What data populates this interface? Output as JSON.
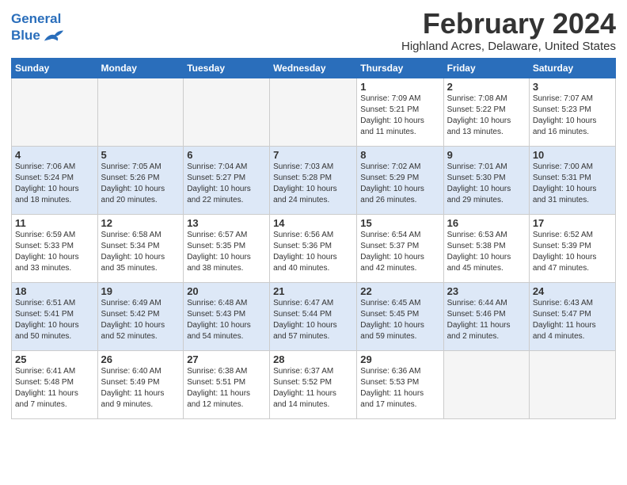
{
  "header": {
    "logo_line1": "General",
    "logo_line2": "Blue",
    "month": "February 2024",
    "location": "Highland Acres, Delaware, United States"
  },
  "days_of_week": [
    "Sunday",
    "Monday",
    "Tuesday",
    "Wednesday",
    "Thursday",
    "Friday",
    "Saturday"
  ],
  "weeks": [
    [
      {
        "day": "",
        "info": ""
      },
      {
        "day": "",
        "info": ""
      },
      {
        "day": "",
        "info": ""
      },
      {
        "day": "",
        "info": ""
      },
      {
        "day": "1",
        "info": "Sunrise: 7:09 AM\nSunset: 5:21 PM\nDaylight: 10 hours\nand 11 minutes."
      },
      {
        "day": "2",
        "info": "Sunrise: 7:08 AM\nSunset: 5:22 PM\nDaylight: 10 hours\nand 13 minutes."
      },
      {
        "day": "3",
        "info": "Sunrise: 7:07 AM\nSunset: 5:23 PM\nDaylight: 10 hours\nand 16 minutes."
      }
    ],
    [
      {
        "day": "4",
        "info": "Sunrise: 7:06 AM\nSunset: 5:24 PM\nDaylight: 10 hours\nand 18 minutes."
      },
      {
        "day": "5",
        "info": "Sunrise: 7:05 AM\nSunset: 5:26 PM\nDaylight: 10 hours\nand 20 minutes."
      },
      {
        "day": "6",
        "info": "Sunrise: 7:04 AM\nSunset: 5:27 PM\nDaylight: 10 hours\nand 22 minutes."
      },
      {
        "day": "7",
        "info": "Sunrise: 7:03 AM\nSunset: 5:28 PM\nDaylight: 10 hours\nand 24 minutes."
      },
      {
        "day": "8",
        "info": "Sunrise: 7:02 AM\nSunset: 5:29 PM\nDaylight: 10 hours\nand 26 minutes."
      },
      {
        "day": "9",
        "info": "Sunrise: 7:01 AM\nSunset: 5:30 PM\nDaylight: 10 hours\nand 29 minutes."
      },
      {
        "day": "10",
        "info": "Sunrise: 7:00 AM\nSunset: 5:31 PM\nDaylight: 10 hours\nand 31 minutes."
      }
    ],
    [
      {
        "day": "11",
        "info": "Sunrise: 6:59 AM\nSunset: 5:33 PM\nDaylight: 10 hours\nand 33 minutes."
      },
      {
        "day": "12",
        "info": "Sunrise: 6:58 AM\nSunset: 5:34 PM\nDaylight: 10 hours\nand 35 minutes."
      },
      {
        "day": "13",
        "info": "Sunrise: 6:57 AM\nSunset: 5:35 PM\nDaylight: 10 hours\nand 38 minutes."
      },
      {
        "day": "14",
        "info": "Sunrise: 6:56 AM\nSunset: 5:36 PM\nDaylight: 10 hours\nand 40 minutes."
      },
      {
        "day": "15",
        "info": "Sunrise: 6:54 AM\nSunset: 5:37 PM\nDaylight: 10 hours\nand 42 minutes."
      },
      {
        "day": "16",
        "info": "Sunrise: 6:53 AM\nSunset: 5:38 PM\nDaylight: 10 hours\nand 45 minutes."
      },
      {
        "day": "17",
        "info": "Sunrise: 6:52 AM\nSunset: 5:39 PM\nDaylight: 10 hours\nand 47 minutes."
      }
    ],
    [
      {
        "day": "18",
        "info": "Sunrise: 6:51 AM\nSunset: 5:41 PM\nDaylight: 10 hours\nand 50 minutes."
      },
      {
        "day": "19",
        "info": "Sunrise: 6:49 AM\nSunset: 5:42 PM\nDaylight: 10 hours\nand 52 minutes."
      },
      {
        "day": "20",
        "info": "Sunrise: 6:48 AM\nSunset: 5:43 PM\nDaylight: 10 hours\nand 54 minutes."
      },
      {
        "day": "21",
        "info": "Sunrise: 6:47 AM\nSunset: 5:44 PM\nDaylight: 10 hours\nand 57 minutes."
      },
      {
        "day": "22",
        "info": "Sunrise: 6:45 AM\nSunset: 5:45 PM\nDaylight: 10 hours\nand 59 minutes."
      },
      {
        "day": "23",
        "info": "Sunrise: 6:44 AM\nSunset: 5:46 PM\nDaylight: 11 hours\nand 2 minutes."
      },
      {
        "day": "24",
        "info": "Sunrise: 6:43 AM\nSunset: 5:47 PM\nDaylight: 11 hours\nand 4 minutes."
      }
    ],
    [
      {
        "day": "25",
        "info": "Sunrise: 6:41 AM\nSunset: 5:48 PM\nDaylight: 11 hours\nand 7 minutes."
      },
      {
        "day": "26",
        "info": "Sunrise: 6:40 AM\nSunset: 5:49 PM\nDaylight: 11 hours\nand 9 minutes."
      },
      {
        "day": "27",
        "info": "Sunrise: 6:38 AM\nSunset: 5:51 PM\nDaylight: 11 hours\nand 12 minutes."
      },
      {
        "day": "28",
        "info": "Sunrise: 6:37 AM\nSunset: 5:52 PM\nDaylight: 11 hours\nand 14 minutes."
      },
      {
        "day": "29",
        "info": "Sunrise: 6:36 AM\nSunset: 5:53 PM\nDaylight: 11 hours\nand 17 minutes."
      },
      {
        "day": "",
        "info": ""
      },
      {
        "day": "",
        "info": ""
      }
    ]
  ]
}
